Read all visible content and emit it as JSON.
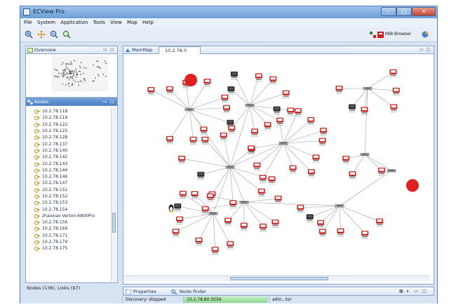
{
  "window": {
    "title": "ECView Pro"
  },
  "menu": [
    "File",
    "System",
    "Application",
    "Tools",
    "View",
    "Map",
    "Help"
  ],
  "toolbar": {
    "icons": [
      "zoom-in-icon",
      "move-icon",
      "zoom-out-icon",
      "zoom-fit-icon"
    ],
    "mib_browser_label": "MIB Browser"
  },
  "overview_panel": {
    "tab_label": "Overview"
  },
  "nodes_panel": {
    "tab_label": "Nodes",
    "items": [
      "10.2.78.118",
      "10.2.78.119",
      "10.2.78.122",
      "10.2.78.125",
      "10.2.78.128",
      "10.2.78.137",
      "10.2.78.140",
      "10.2.78.142",
      "10.2.78.143",
      "10.2.78.144",
      "10.2.78.146",
      "10.2.78.147",
      "10.2.78.151",
      "10.2.78.152",
      "10.2.78.153",
      "10.2.78.154",
      "zhaoxiao-Verton-6800Pro",
      "10.2.78.156",
      "10.2.78.169",
      "10.2.78.171",
      "10.2.78.174",
      "10.2.78.175"
    ],
    "summary": "Nodes (136), Links (97)"
  },
  "map_panel": {
    "tabs": [
      {
        "label": "MainMap",
        "active": false
      },
      {
        "label": "10.2.78.0",
        "active": true
      }
    ]
  },
  "bottom_panel": {
    "tabs": [
      {
        "label": "Properties",
        "active": true
      },
      {
        "label": "Node finder",
        "active": false
      }
    ]
  },
  "statusbar": {
    "discovery": "Discovery: stopped",
    "address": "10.2.78.80.5556",
    "user": "adm...tor"
  },
  "colors": {
    "titlebar": "#7fabd9",
    "node_red": "#c8201c",
    "node_dark": "#2a2a2a",
    "alarm_red": "#e02020"
  }
}
